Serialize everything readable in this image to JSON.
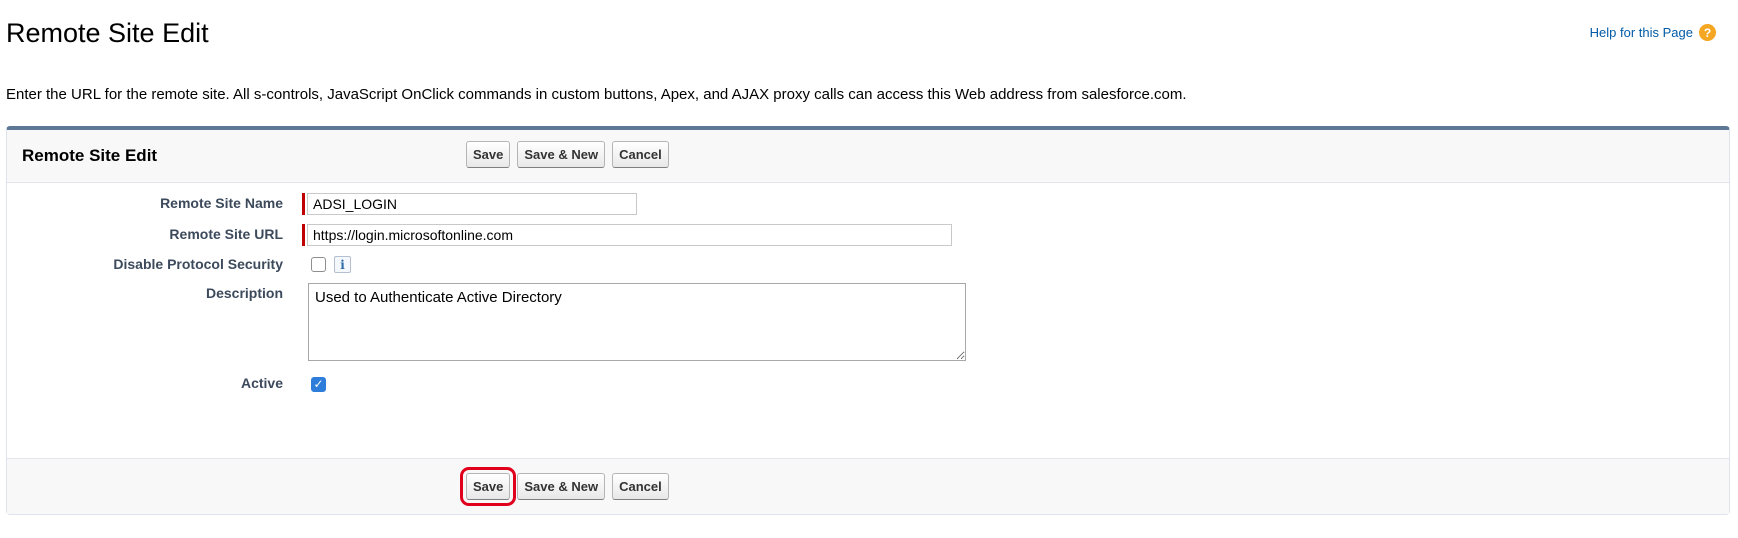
{
  "page": {
    "title": "Remote Site Edit",
    "help_link": "Help for this Page",
    "help_icon": "question-mark-icon",
    "intro": "Enter the URL for the remote site. All s-controls, JavaScript OnClick commands in custom buttons, Apex, and AJAX proxy calls can access this Web address from salesforce.com."
  },
  "panel": {
    "title": "Remote Site Edit",
    "buttons": {
      "save": "Save",
      "save_new": "Save & New",
      "cancel": "Cancel"
    }
  },
  "form": {
    "remote_site_name": {
      "label": "Remote Site Name",
      "value": "ADSI_LOGIN",
      "required": true
    },
    "remote_site_url": {
      "label": "Remote Site URL",
      "value": "https://login.microsoftonline.com",
      "required": true
    },
    "disable_protocol_security": {
      "label": "Disable Protocol Security",
      "checked": false,
      "info_icon": "i"
    },
    "description": {
      "label": "Description",
      "value": "Used to Authenticate Active Directory"
    },
    "active": {
      "label": "Active",
      "checked": true
    }
  },
  "colors": {
    "header_border": "#5f7797",
    "required_marker": "#c00000",
    "highlight_outline": "#e0001b",
    "checkbox_checked": "#2f7ddb",
    "help_icon": "#f5a623"
  }
}
